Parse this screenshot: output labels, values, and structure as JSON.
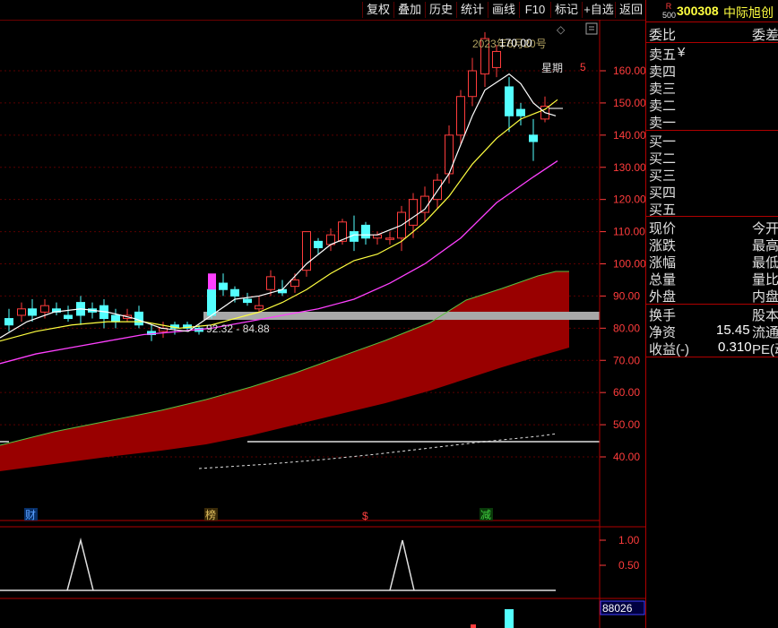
{
  "toolbar": {
    "buttons": [
      "复权",
      "叠加",
      "历史",
      "统计",
      "画线",
      "F10",
      "标记",
      "+自选",
      "返回"
    ]
  },
  "chart": {
    "price_axis": [
      "160.00",
      "150.00",
      "140.00",
      "130.00",
      "120.00",
      "110.00",
      "100.00",
      "90.00",
      "80.00",
      "70.00",
      "60.00",
      "50.00",
      "40.00"
    ],
    "high_label": "170.00",
    "date_label": "2023年6月20号",
    "weekday_label": "星期",
    "weekday_value": "5",
    "range_label": "92.32 - 84.88",
    "markers": [
      {
        "text": "财",
        "color": "#5aa0ff"
      },
      {
        "text": "榜",
        "color": "#e0c060"
      },
      {
        "text": "$",
        "color": "#ff4040"
      },
      {
        "text": "减",
        "color": "#40d040"
      }
    ]
  },
  "indicator": {
    "axis": [
      "1.00",
      "0.50"
    ]
  },
  "volume": {
    "value": "88026"
  },
  "colors": {
    "up": "#ff3c3c",
    "down": "#54ffff",
    "ma5": "#ffffff",
    "ma10": "#ffff40",
    "ma20": "#ff40ff",
    "band": "#990000",
    "grid": "#5a0000",
    "axis_text": "#ff3c3c"
  },
  "panel": {
    "code": "300308",
    "name": "中际旭创",
    "badge_top": "R",
    "badge_bottom": "500",
    "weibi": "委比",
    "weicha": "委差",
    "sell": [
      "卖五",
      "卖四",
      "卖三",
      "卖二",
      "卖一"
    ],
    "sell5_suffix": "¥",
    "buy": [
      "买一",
      "买二",
      "买三",
      "买四",
      "买五"
    ],
    "stats_left": [
      "现价",
      "涨跌",
      "涨幅",
      "总量",
      "外盘"
    ],
    "stats_right": [
      "今开",
      "最高",
      "最低",
      "量比",
      "内盘"
    ],
    "huanshou": "换手",
    "guben": "股本",
    "jingzi": "净资",
    "jingzi_value": "15.45",
    "liutong": "流通",
    "shouyi": "收益(-)",
    "shouyi_value": "0.310",
    "pe": "PE(动"
  }
}
